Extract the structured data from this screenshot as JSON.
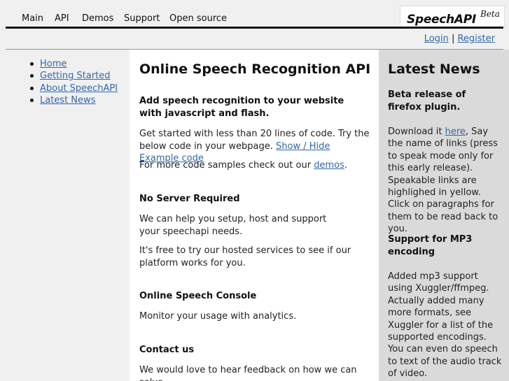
{
  "topnav": {
    "items": [
      "Main",
      "API",
      "Demos",
      "Support",
      "Open source"
    ]
  },
  "logo": {
    "name": "SpeechAPI",
    "badge": "Beta"
  },
  "auth": {
    "login": "Login",
    "separator": "|",
    "register": "Register"
  },
  "sidebar": {
    "items": [
      "Home",
      "Getting Started",
      "About SpeechAPI",
      "Latest News"
    ]
  },
  "main": {
    "title": "Online Speech Recognition API",
    "intro_heading": "Add speech recognition to your website with javascript and flash.",
    "intro_p1_text": "Get started with less than 20 lines of code. Try the below code in your webpage.",
    "intro_p1_link": "Show / Hide Example code",
    "intro_p2_text": "For more code samples check out our",
    "intro_p2_link": "demos",
    "intro_p2_end": ".",
    "noserver_heading": "No Server Required",
    "noserver_p1": "We can help you setup, host and support your speechapi needs.",
    "noserver_p2": "It's free to try our hosted services to see if our platform works for you.",
    "console_heading": "Online Speech Console",
    "console_p1": "Monitor your usage with analytics.",
    "contact_heading": "Contact us",
    "contact_p1": "We would love to hear feedback on how we can solve"
  },
  "news": {
    "title": "Latest News",
    "item1_heading": "Beta release of firefox plugin.",
    "item1_pre": "Download it",
    "item1_link": "here",
    "item1_post": ", Say the name of links (press to speak mode only for this early release). Speakable links are highlighed in yellow. Click on paragraphs for them to be read back to you.",
    "item2_heading": "Support for MP3 encoding",
    "item2_text": "Added mp3 support using Xuggler/ffmpeg. Actually added many more formats, see Xuggler for a list of the supported encodings. You can even do speech to text of the audio track of video."
  }
}
